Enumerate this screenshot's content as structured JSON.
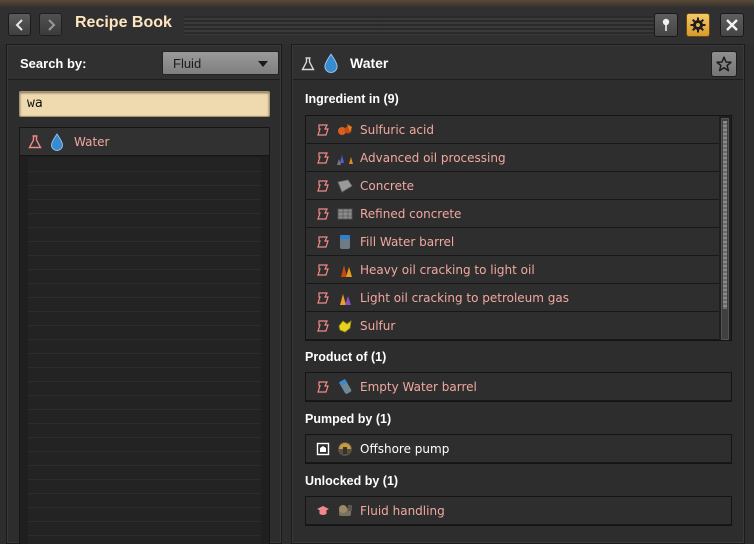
{
  "window": {
    "title": "Recipe Book"
  },
  "search": {
    "label": "Search by:",
    "type_selected": "Fluid",
    "query": "wa"
  },
  "results": [
    {
      "label": "Water",
      "icon": "water-drop-icon",
      "type_icon": "flask-icon"
    }
  ],
  "detail": {
    "title": "Water",
    "icon": "water-drop-icon",
    "sections": {
      "ingredient_in": {
        "title": "Ingredient in (9)",
        "items": [
          {
            "label": "Sulfuric acid",
            "icon": "sulfuric-acid-icon"
          },
          {
            "label": "Advanced oil processing",
            "icon": "advanced-oil-processing-icon"
          },
          {
            "label": "Concrete",
            "icon": "concrete-icon"
          },
          {
            "label": "Refined concrete",
            "icon": "refined-concrete-icon"
          },
          {
            "label": "Fill Water barrel",
            "icon": "water-barrel-icon"
          },
          {
            "label": "Heavy oil cracking to light oil",
            "icon": "heavy-oil-cracking-icon"
          },
          {
            "label": "Light oil cracking to petroleum gas",
            "icon": "light-oil-cracking-icon"
          },
          {
            "label": "Sulfur",
            "icon": "sulfur-icon"
          }
        ]
      },
      "product_of": {
        "title": "Product of (1)",
        "items": [
          {
            "label": "Empty Water barrel",
            "icon": "empty-barrel-icon"
          }
        ]
      },
      "pumped_by": {
        "title": "Pumped by (1)",
        "items": [
          {
            "label": "Offshore pump",
            "icon": "offshore-pump-icon"
          }
        ]
      },
      "unlocked_by": {
        "title": "Unlocked by (1)",
        "items": [
          {
            "label": "Fluid handling",
            "icon": "fluid-handling-icon"
          }
        ]
      }
    }
  },
  "colors": {
    "recipe_text": "#f0a8a0",
    "accent_active": "#e0a73a",
    "search_field": "#eedaae"
  }
}
